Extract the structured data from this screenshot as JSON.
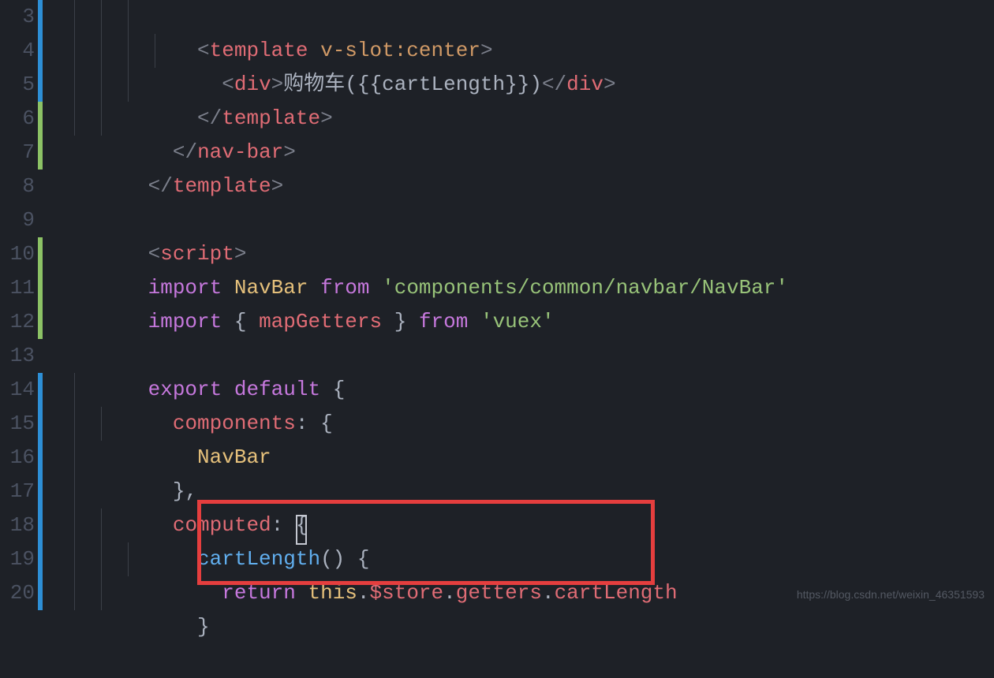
{
  "lines": {
    "3": {
      "marker": "blue"
    },
    "4": {
      "marker": "blue"
    },
    "5": {
      "marker": "blue"
    },
    "6": {
      "marker": "green"
    },
    "7": {
      "marker": "green"
    },
    "8": {
      "marker": ""
    },
    "9": {
      "marker": ""
    },
    "10": {
      "marker": "green"
    },
    "11": {
      "marker": "green"
    },
    "12": {
      "marker": "green"
    },
    "13": {
      "marker": ""
    },
    "14": {
      "marker": "blue"
    },
    "15": {
      "marker": "blue"
    },
    "16": {
      "marker": "blue"
    },
    "17": {
      "marker": "blue"
    },
    "18": {
      "marker": "blue"
    },
    "19": {
      "marker": "blue"
    },
    "20": {
      "marker": "blue"
    }
  },
  "tokens": {
    "l3_template": "template",
    "l3_attr": "v-slot:center",
    "l4_div_open": "div",
    "l4_text": "购物车({{cartLength}})",
    "l4_div_close": "div",
    "l5_template": "template",
    "l6_navbar": "nav-bar",
    "l7_template": "template",
    "l9_script": "script",
    "l10_import": "import",
    "l10_navbar": "NavBar",
    "l10_from": "from",
    "l10_path": "'components/common/navbar/NavBar'",
    "l11_import": "import",
    "l11_map": "mapGetters",
    "l11_from": "from",
    "l11_vuex": "'vuex'",
    "l13_export": "export",
    "l13_default": "default",
    "l14_components": "components",
    "l15_navbar": "NavBar",
    "l17_computed": "computed",
    "l18_cartlength": "cartLength",
    "l19_return": "return",
    "l19_this": "this",
    "l19_store": "$store",
    "l19_getters": "getters",
    "l19_cartlength": "cartLength"
  },
  "watermark": "https://blog.csdn.net/weixin_46351593"
}
